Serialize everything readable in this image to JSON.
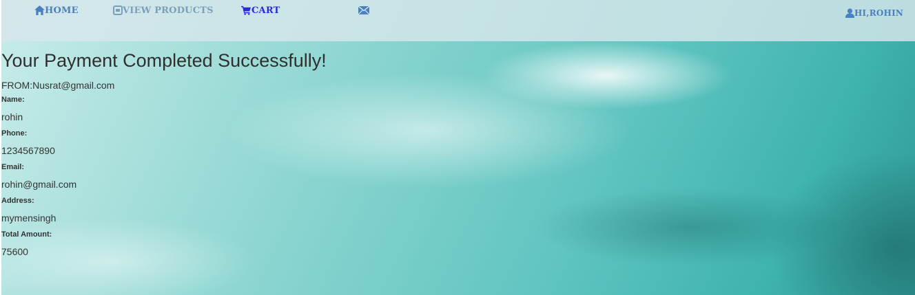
{
  "nav": {
    "home_label": "HOME",
    "products_label": "VIEW PRODUCTS",
    "cart_label": "CART",
    "user_label": "HI,ROHIN"
  },
  "page": {
    "title": "Your Payment Completed Successfully!",
    "from_text": "FROM:Nusrat@gmail.com"
  },
  "fields": [
    {
      "label": "Name:",
      "value": "rohin"
    },
    {
      "label": "Phone:",
      "value": "1234567890"
    },
    {
      "label": "Email:",
      "value": "rohin@gmail.com"
    },
    {
      "label": "Address:",
      "value": "mymensingh"
    },
    {
      "label": "Total Amount:",
      "value": "75600"
    }
  ],
  "icons": {
    "home": "home-icon",
    "products": "box-icon",
    "cart": "cart-icon",
    "mail": "envelope-icon",
    "user": "user-icon"
  },
  "colors": {
    "nav_link": "#4a7fc0",
    "nav_link_muted": "#7a9fb8",
    "nav_cart": "#2a2ad6",
    "text": "#333333"
  }
}
